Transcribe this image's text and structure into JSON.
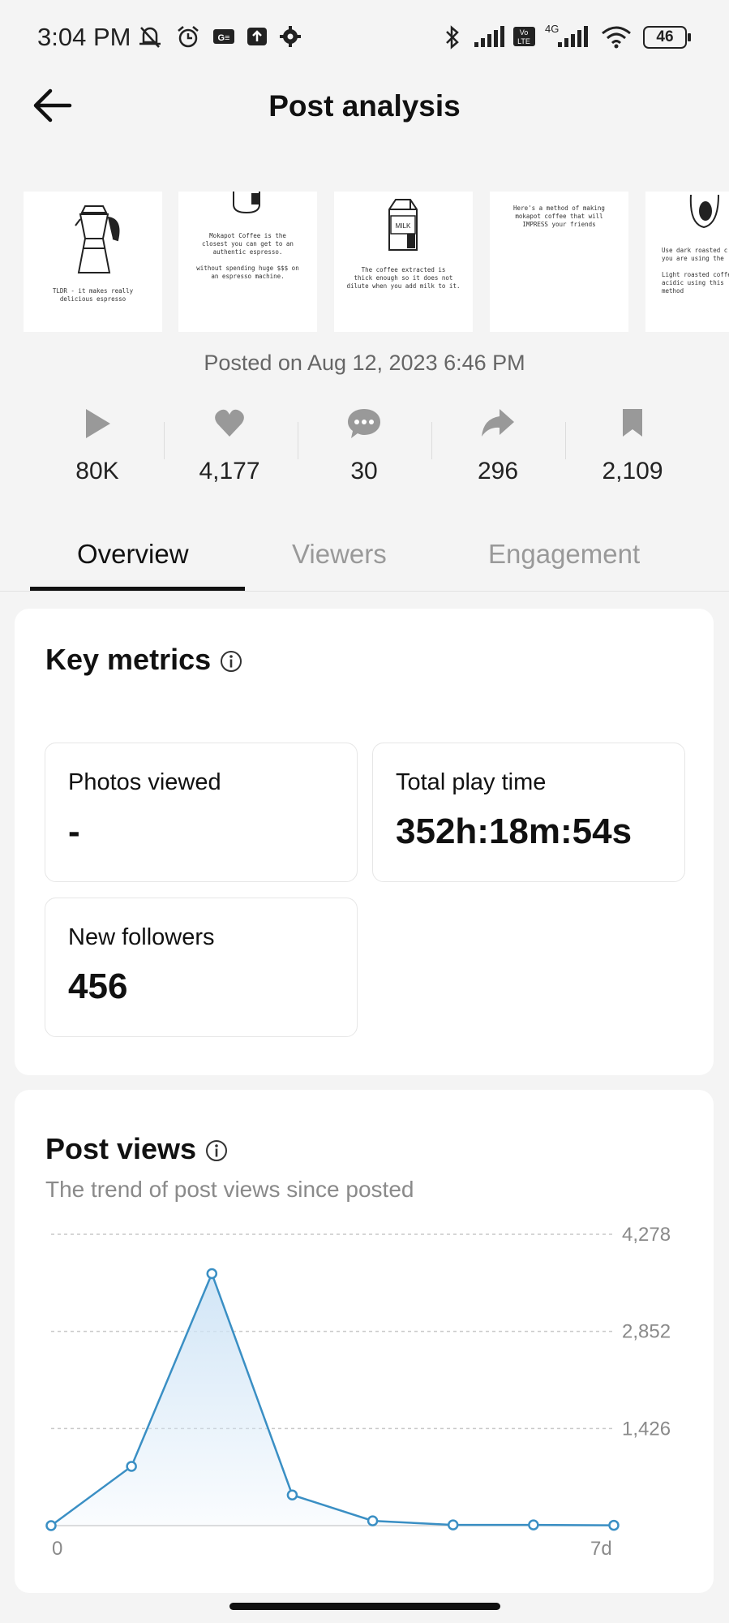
{
  "status_bar": {
    "time": "3:04 PM",
    "battery": "46",
    "network": "4G"
  },
  "header": {
    "title": "Post analysis"
  },
  "thumbnails": [
    {
      "caption": "TLDR - it makes really\ndelicious espresso"
    },
    {
      "caption": "Mokapot Coffee is the\nclosest you can get to an\nauthentic espresso.\n\nwithout spending huge $$$ on\nan espresso machine."
    },
    {
      "caption": "The coffee extracted is\nthick enough so it does not\ndilute when you add milk to it.",
      "label": "MILK"
    },
    {
      "caption": "Here's a method of making\nmokapot coffee that will\nIMPRESS your friends"
    },
    {
      "caption": "Use dark roasted c\nyou are using the\n\nLight roasted coffe\nacidic using this\nmethod"
    }
  ],
  "posted": "Posted on Aug 12, 2023 6:46 PM",
  "stats": [
    {
      "icon": "play-icon",
      "value": "80K"
    },
    {
      "icon": "heart-icon",
      "value": "4,177"
    },
    {
      "icon": "comment-icon",
      "value": "30"
    },
    {
      "icon": "share-icon",
      "value": "296"
    },
    {
      "icon": "bookmark-icon",
      "value": "2,109"
    }
  ],
  "tabs": [
    {
      "label": "Overview",
      "active": true
    },
    {
      "label": "Viewers",
      "active": false
    },
    {
      "label": "Engagement",
      "active": false
    }
  ],
  "key_metrics": {
    "title": "Key metrics",
    "items": [
      {
        "label": "Photos viewed",
        "value": "-"
      },
      {
        "label": "Total play time",
        "value": "352h:18m:54s"
      },
      {
        "label": "New followers",
        "value": "456"
      }
    ]
  },
  "post_views": {
    "title": "Post views",
    "subtitle": "The trend of post views since posted"
  },
  "chart_data": {
    "type": "area",
    "x_labels": [
      "0",
      "7d"
    ],
    "x": [
      0,
      1,
      2,
      3,
      4,
      5,
      6,
      7
    ],
    "y": [
      0,
      870,
      3700,
      450,
      70,
      10,
      10,
      5
    ],
    "y_ticks": [
      "4,278",
      "2,852",
      "1,426"
    ],
    "ylim": [
      0,
      4278
    ],
    "grid": true,
    "color": "#3a8fc4",
    "fill": "#cfe4f6"
  },
  "colors": {
    "accent": "#3a8fc4",
    "text": "#111111",
    "muted": "#999999"
  }
}
